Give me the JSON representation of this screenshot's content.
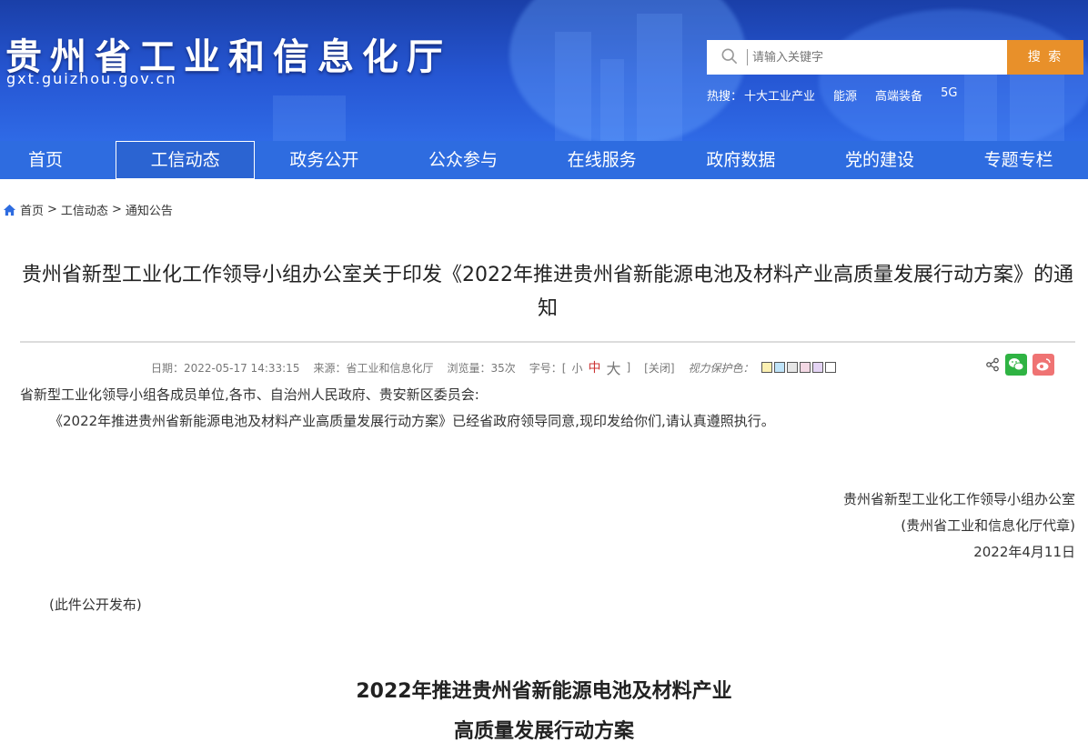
{
  "header": {
    "site_title": "贵州省工业和信息化厅",
    "site_domain": "gxt.guizhou.gov.cn",
    "search_placeholder": "请输入关键字",
    "search_button": "搜 索",
    "hot_label": "热搜：",
    "hot_items": [
      "十大工业产业",
      "能源",
      "高端装备",
      "5G"
    ]
  },
  "nav": {
    "items": [
      "首页",
      "工信动态",
      "政务公开",
      "公众参与",
      "在线服务",
      "政府数据",
      "党的建设",
      "专题专栏"
    ],
    "active": "工信动态"
  },
  "breadcrumb": [
    "首页",
    "工信动态",
    "通知公告"
  ],
  "article": {
    "title": "贵州省新型工业化工作领导小组办公室关于印发《2022年推进贵州省新能源电池及材料产业高质量发展行动方案》的通知",
    "meta": {
      "date": "日期：2022-05-17 14:33:15",
      "source": "来源：省工业和信息化厅",
      "views": "浏览量：35次",
      "font_label": "字号：[",
      "font_small": "小",
      "font_mid": "中",
      "font_big": "大",
      "font_end": "]",
      "close": "[关闭]",
      "eye_care": "视力保护色：",
      "eye_colors": [
        "#fbf0b2",
        "#bfe3f8",
        "#e6e6e6",
        "#f3d8e4",
        "#e4d4f4",
        "#ffffff"
      ]
    },
    "salutation": "省新型工业化领导小组各成员单位,各市、自治州人民政府、贵安新区委员会:",
    "body": "《2022年推进贵州省新能源电池及材料产业高质量发展行动方案》已经省政府领导同意,现印发给你们,请认真遵照执行。",
    "sign_org": "贵州省新型工业化工作领导小组办公室",
    "sign_seal": "(贵州省工业和信息化厅代章)",
    "sign_date": "2022年4月11日",
    "publish_note": "(此件公开发布)",
    "sub_title_1": "2022年推进贵州省新能源电池及材料产业",
    "sub_title_2": "高质量发展行动方案"
  },
  "colors": {
    "banner": "#2657d4",
    "nav": "#2e6ce0",
    "search_button": "#e8902a"
  }
}
